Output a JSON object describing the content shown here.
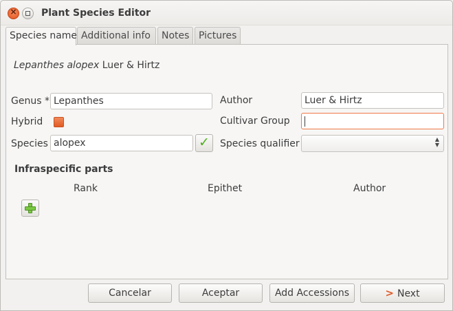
{
  "window": {
    "title": "Plant Species Editor"
  },
  "tabs": [
    {
      "label": "Species name",
      "active": true
    },
    {
      "label": "Additional info",
      "active": false
    },
    {
      "label": "Notes",
      "active": false
    },
    {
      "label": "Pictures",
      "active": false
    }
  ],
  "summary": {
    "genus_species": "Lepanthes alopex",
    "author": "Luer & Hirtz"
  },
  "form": {
    "genus_label": "Genus *",
    "genus_value": "Lepanthes",
    "author_label": "Author",
    "author_value": "Luer & Hirtz",
    "hybrid_label": "Hybrid",
    "hybrid_checked": false,
    "cultivar_label": "Cultivar Group",
    "cultivar_value": "",
    "species_label": "Species",
    "species_value": "alopex",
    "qualifier_label": "Species qualifier",
    "qualifier_value": ""
  },
  "infraspecific": {
    "title": "Infraspecific parts",
    "columns": [
      "Rank",
      "Epithet",
      "Author"
    ]
  },
  "buttons": {
    "cancel": "Cancelar",
    "accept": "Aceptar",
    "add_accessions": "Add Accessions",
    "next": "Next"
  },
  "colors": {
    "accent": "#e05a24",
    "ok_green": "#4caf1d",
    "add_green": "#7ac943"
  }
}
